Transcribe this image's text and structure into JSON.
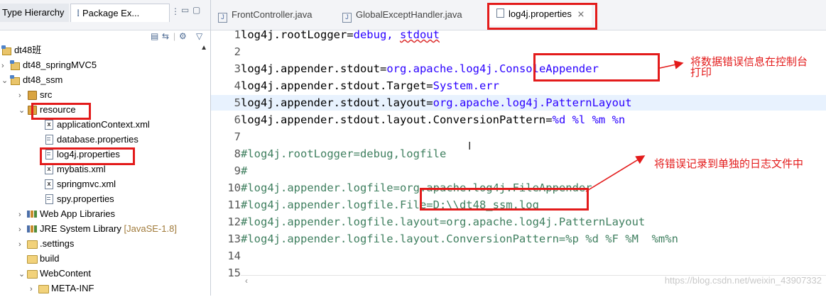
{
  "left_panel": {
    "tabs": [
      {
        "label": "Type Hierarchy"
      },
      {
        "label": "Package Ex..."
      }
    ],
    "tree": [
      {
        "label": "dt48班",
        "icon": "working-set-icon",
        "expanded": null
      },
      {
        "label": "dt48_springMVC5",
        "icon": "project-icon",
        "expanded": false
      },
      {
        "label": "dt48_ssm",
        "icon": "project-icon",
        "expanded": true
      },
      {
        "label": "src",
        "icon": "source-folder-icon",
        "expanded": false
      },
      {
        "label": "resource",
        "icon": "source-folder-icon",
        "expanded": true
      },
      {
        "label": "applicationContext.xml",
        "icon": "xml-file-icon"
      },
      {
        "label": "database.properties",
        "icon": "properties-file-icon"
      },
      {
        "label": "log4j.properties",
        "icon": "properties-file-icon"
      },
      {
        "label": "mybatis.xml",
        "icon": "xml-file-icon"
      },
      {
        "label": "springmvc.xml",
        "icon": "xml-file-icon"
      },
      {
        "label": "spy.properties",
        "icon": "properties-file-icon"
      },
      {
        "label": "Web App Libraries",
        "icon": "library-icon",
        "expanded": false
      },
      {
        "label": "JRE System Library",
        "suffix": "[JavaSE-1.8]",
        "icon": "library-icon",
        "expanded": false
      },
      {
        "label": ".settings",
        "icon": "folder-icon",
        "expanded": false
      },
      {
        "label": "build",
        "icon": "folder-icon"
      },
      {
        "label": "WebContent",
        "icon": "folder-icon",
        "expanded": true
      },
      {
        "label": "META-INF",
        "icon": "folder-icon",
        "expanded": false
      }
    ]
  },
  "editor": {
    "tabs": [
      {
        "label": "FrontController.java"
      },
      {
        "label": "GlobalExceptHandler.java"
      },
      {
        "label": "log4j.properties",
        "close": "⨯"
      }
    ],
    "lines": [
      {
        "n": "1",
        "key": "log4j.rootLogger=",
        "val": "debug, ",
        "val2": "stdout"
      },
      {
        "n": "2"
      },
      {
        "n": "3",
        "key": "log4j.appender.stdout=",
        "val": "org.apache.log4j.ConsoleAppender"
      },
      {
        "n": "4",
        "key": "log4j.appender.stdout.Target=",
        "val": "System.err"
      },
      {
        "n": "5",
        "key": "log4j.appender.stdout.layout=",
        "val": "org.apache.log4j.PatternLayout"
      },
      {
        "n": "6",
        "key": "log4j.appender.stdout.layout.ConversionPattern=",
        "val": "%d %l %m %n"
      },
      {
        "n": "7"
      },
      {
        "n": "8",
        "comment": "#log4j.rootLogger=debug,logfile"
      },
      {
        "n": "9",
        "comment": "#"
      },
      {
        "n": "10",
        "comment": "#log4j.appender.logfile=org.apache.log4j.FileAppender"
      },
      {
        "n": "11",
        "comment": "#log4j.appender.logfile.File=D:\\\\dt48_ssm.log"
      },
      {
        "n": "12",
        "comment": "#log4j.appender.logfile.layout=org.apache.log4j.PatternLayout"
      },
      {
        "n": "13",
        "comment": "#log4j.appender.logfile.layout.ConversionPattern=%p %d %F %M  %m%n"
      },
      {
        "n": "14"
      },
      {
        "n": "15"
      }
    ],
    "annotation_console": "将数据错误信息在控制台\n打印",
    "annotation_file": "将错误记录到单独的日志文件中",
    "watermark": "https://blog.csdn.net/weixin_43907332"
  },
  "colors": {
    "highlight_red": "#e31b1b",
    "value_blue": "#2a00ff",
    "comment_green": "#3f7f5f"
  }
}
